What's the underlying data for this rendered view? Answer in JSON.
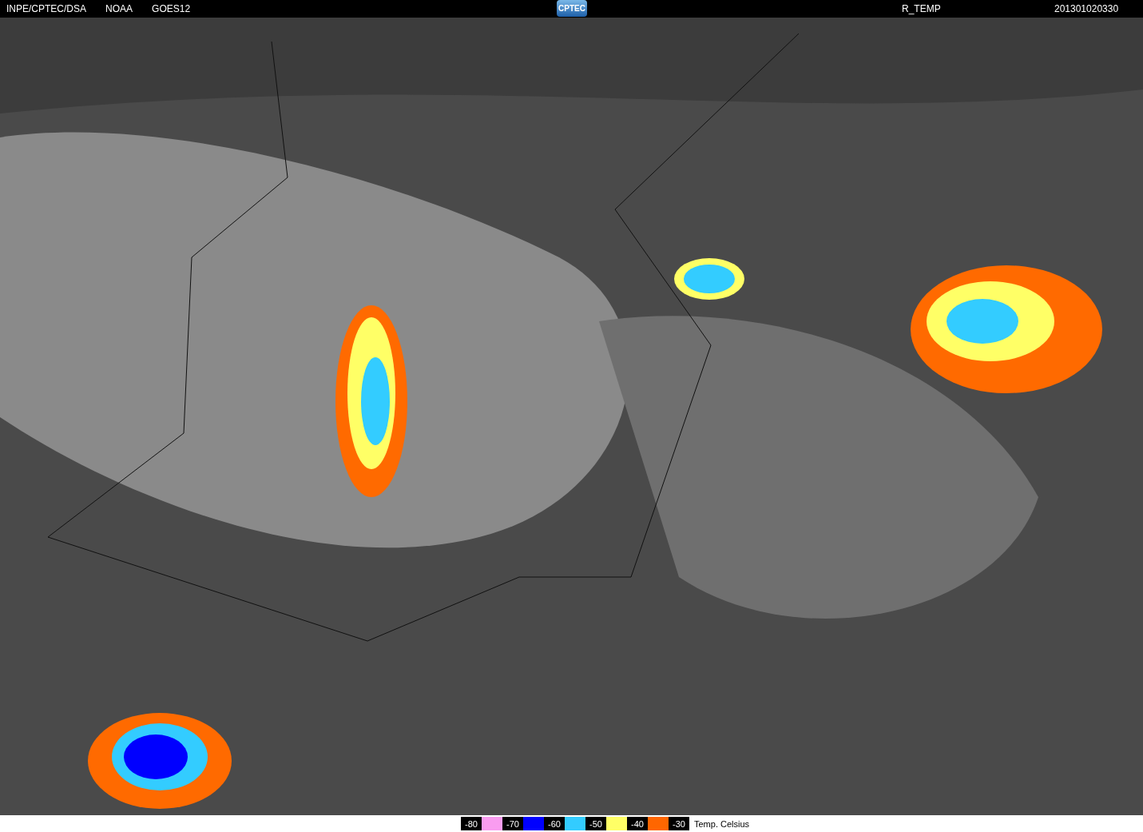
{
  "header": {
    "sources": [
      "INPE/CPTEC/DSA",
      "NOAA",
      "GOES12"
    ],
    "logo": "CPTEC",
    "product": "R_TEMP",
    "timestamp": "201301020330"
  },
  "legend": {
    "steps": [
      {
        "label": "-80",
        "color": "#f99cf0"
      },
      {
        "label": "-70",
        "color": "#0000ff"
      },
      {
        "label": "-60",
        "color": "#33ccff"
      },
      {
        "label": "-50",
        "color": "#ffff66"
      },
      {
        "label": "-40",
        "color": "#ff6600"
      },
      {
        "label": "-30"
      }
    ],
    "title": "Temp. Celsius"
  }
}
